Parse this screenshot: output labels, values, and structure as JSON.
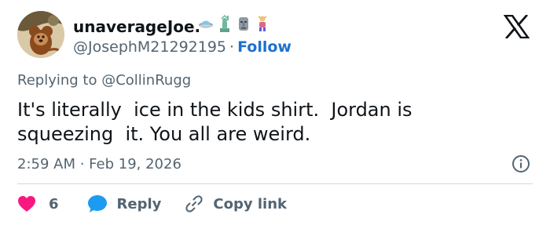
{
  "user": {
    "display_name": "unaverageJoe.",
    "handle": "@JosephM21292195",
    "separator": "·",
    "follow_label": "Follow",
    "badges": [
      "ufo-emoji",
      "statue-of-liberty-emoji",
      "moai-emoji",
      "person-emoji"
    ]
  },
  "tweet": {
    "reply_prefix": "Replying to",
    "reply_mention": "@CollinRugg",
    "text": "It's literally  ice in the kids shirt.  Jordan is\nsqueezing  it. You all are weird.",
    "timestamp": "2:59 AM · Feb 19, 2026"
  },
  "actions": {
    "like_count": "6",
    "reply_label": "Reply",
    "copy_label": "Copy link"
  },
  "colors": {
    "accent": "#1d70cf",
    "like": "#f91880",
    "reply": "#1d9bf0",
    "muted": "#536471"
  }
}
